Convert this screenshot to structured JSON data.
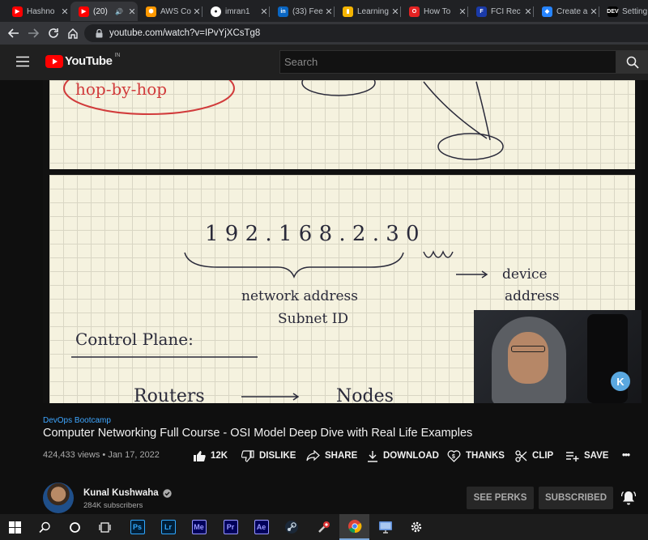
{
  "browser": {
    "tabs": [
      {
        "title": "Hashno",
        "favicon": "youtube-icon",
        "color": "#ff0000",
        "glyph": "▶"
      },
      {
        "title": "(20)",
        "favicon": "youtube-icon",
        "color": "#ff0000",
        "glyph": "▶",
        "audio": true,
        "active": true
      },
      {
        "title": "AWS Co",
        "favicon": "aws-icon",
        "color": "#ff9900",
        "glyph": "⬢"
      },
      {
        "title": "imran1",
        "favicon": "github-icon",
        "color": "#ffffff",
        "glyph": "●"
      },
      {
        "title": "(33) Fee",
        "favicon": "linkedin-icon",
        "color": "#0a66c2",
        "glyph": "in"
      },
      {
        "title": "Learning",
        "favicon": "learning-icon",
        "color": "#f4b400",
        "glyph": "▮"
      },
      {
        "title": "How To",
        "favicon": "opera-icon",
        "color": "#e52222",
        "glyph": "O"
      },
      {
        "title": "FCI Rec",
        "favicon": "fci-icon",
        "color": "#1a3aa8",
        "glyph": "F"
      },
      {
        "title": "Create a",
        "favicon": "atlassian-icon",
        "color": "#2684ff",
        "glyph": "◆"
      },
      {
        "title": "Setting",
        "favicon": "dev-icon",
        "color": "#000000",
        "glyph": "DEV"
      }
    ],
    "url": "youtube.com/watch?v=IPvYjXCsTg8"
  },
  "youtube": {
    "logo_text": "YouTube",
    "region": "IN",
    "search_placeholder": "Search"
  },
  "video": {
    "whiteboard": {
      "top_text": "hop-by-hop",
      "ip": "1 9 2 . 1 6 8 . 2 . 3 0",
      "network_label": "network address",
      "subnet_label": "Subnet ID",
      "device_label_1": "device",
      "device_label_2": "address",
      "control_plane": "Control Plane:",
      "routers": "Routers",
      "nodes": "Nodes"
    },
    "playlist": "DevOps Bootcamp",
    "title": "Computer Networking Full Course - OSI Model Deep Dive with Real Life Examples",
    "views": "424,433 views",
    "date": "Jan 17, 2022",
    "actions": {
      "like": "12K",
      "dislike": "DISLIKE",
      "share": "SHARE",
      "download": "DOWNLOAD",
      "thanks": "THANKS",
      "clip": "CLIP",
      "save": "SAVE",
      "more": "•••"
    }
  },
  "channel": {
    "name": "Kunal Kushwaha",
    "subscribers": "284K subscribers",
    "perks_label": "SEE PERKS",
    "subscribed_label": "SUBSCRIBED"
  },
  "taskbar": {
    "apps": [
      {
        "name": "windows-start-icon",
        "label": ""
      },
      {
        "name": "search-icon",
        "label": ""
      },
      {
        "name": "cortana-icon",
        "label": ""
      },
      {
        "name": "task-view-icon",
        "label": ""
      },
      {
        "name": "photoshop-icon",
        "label": "Ps",
        "bg": "#001e36",
        "fg": "#31a8ff"
      },
      {
        "name": "lightroom-icon",
        "label": "Lr",
        "bg": "#001e36",
        "fg": "#31a8ff"
      },
      {
        "name": "media-encoder-icon",
        "label": "Me",
        "bg": "#00005b",
        "fg": "#9999ff"
      },
      {
        "name": "premiere-icon",
        "label": "Pr",
        "bg": "#00005b",
        "fg": "#9999ff"
      },
      {
        "name": "after-effects-icon",
        "label": "Ae",
        "bg": "#00005b",
        "fg": "#9999ff"
      },
      {
        "name": "steam-icon",
        "label": ""
      },
      {
        "name": "tool-icon",
        "label": ""
      },
      {
        "name": "chrome-icon",
        "label": ""
      },
      {
        "name": "monitor-icon",
        "label": ""
      },
      {
        "name": "settings-icon",
        "label": ""
      }
    ]
  }
}
